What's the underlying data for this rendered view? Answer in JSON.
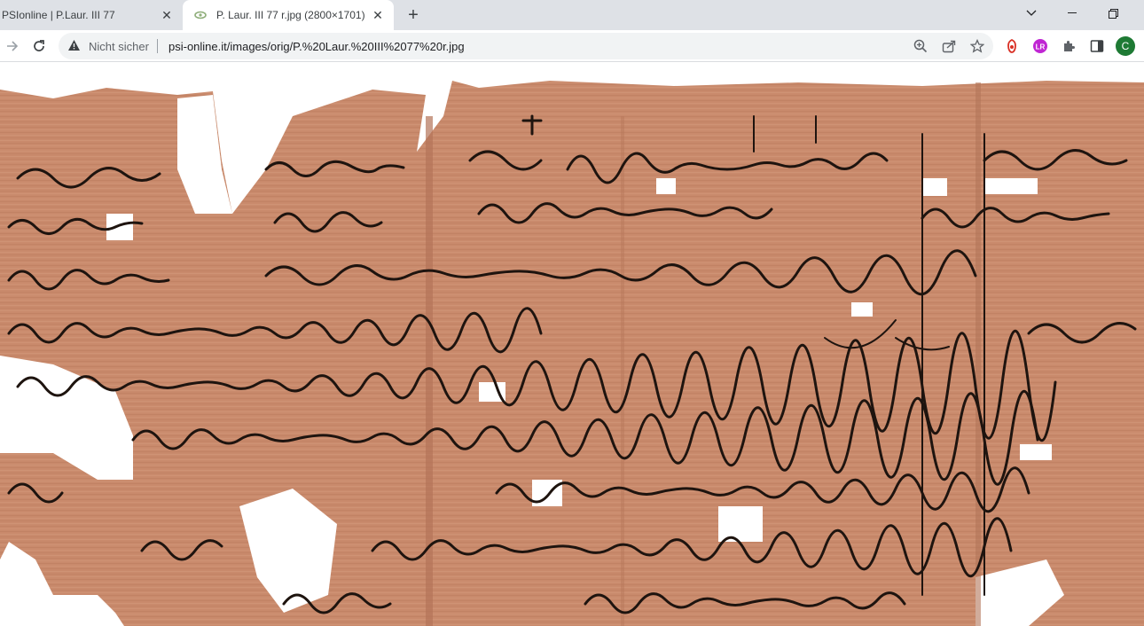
{
  "tabs": [
    {
      "title": "PSIonline | P.Laur. III 77",
      "active": false
    },
    {
      "title": "P. Laur. III 77 r.jpg (2800×1701)",
      "active": true
    }
  ],
  "omnibox": {
    "security_label": "Nicht sicher",
    "url": "psi-online.it/images/orig/P.%20Laur.%20III%2077%20r.jpg"
  },
  "profile": {
    "initial": "C",
    "color": "#1e7a34"
  },
  "image": {
    "description_icon": "image-icon",
    "papyrus_color": "#c8856a"
  }
}
